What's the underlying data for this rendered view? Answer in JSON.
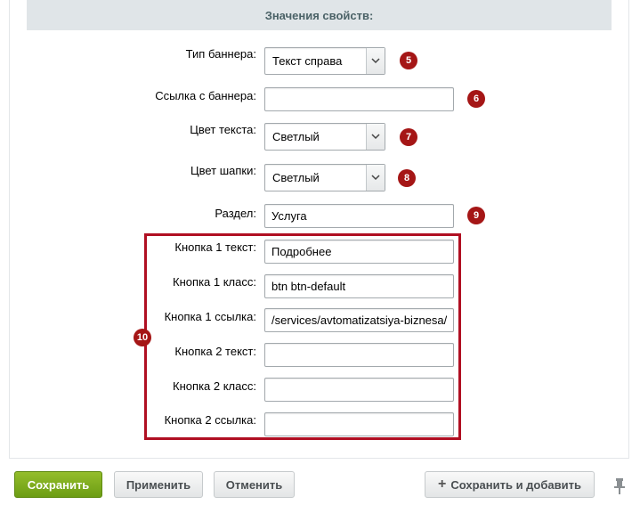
{
  "section": {
    "title": "Значения свойств:"
  },
  "fields": {
    "banner_type": {
      "label": "Тип баннера:",
      "value": "Текст справа",
      "badge": "5"
    },
    "banner_link": {
      "label": "Ссылка с баннера:",
      "value": "",
      "badge": "6"
    },
    "text_color": {
      "label": "Цвет текста:",
      "value": "Светлый",
      "badge": "7"
    },
    "header_color": {
      "label": "Цвет шапки:",
      "value": "Светлый",
      "badge": "8"
    },
    "section_field": {
      "label": "Раздел:",
      "value": "Услуга",
      "badge": "9"
    },
    "button1_text": {
      "label": "Кнопка 1 текст:",
      "value": "Подробнее"
    },
    "button1_class": {
      "label": "Кнопка 1 класс:",
      "value": "btn btn-default"
    },
    "button1_link": {
      "label": "Кнопка 1 ссылка:",
      "value": "/services/avtomatizatsiya-biznesa/b"
    },
    "button2_text": {
      "label": "Кнопка 2 текст:",
      "value": ""
    },
    "button2_class": {
      "label": "Кнопка 2 класс:",
      "value": ""
    },
    "button2_link": {
      "label": "Кнопка 2 ссылка:",
      "value": ""
    },
    "group_badge": "10"
  },
  "footer": {
    "save": "Сохранить",
    "apply": "Применить",
    "cancel": "Отменить",
    "save_add": "Сохранить и добавить"
  },
  "icons": {
    "dropdown": "chevron-down-icon",
    "plus": "plus-icon",
    "pin": "pin-icon"
  },
  "colors": {
    "badge": "#a51616",
    "highlight_border": "#b00f22",
    "save_button": "#7aa81c"
  }
}
